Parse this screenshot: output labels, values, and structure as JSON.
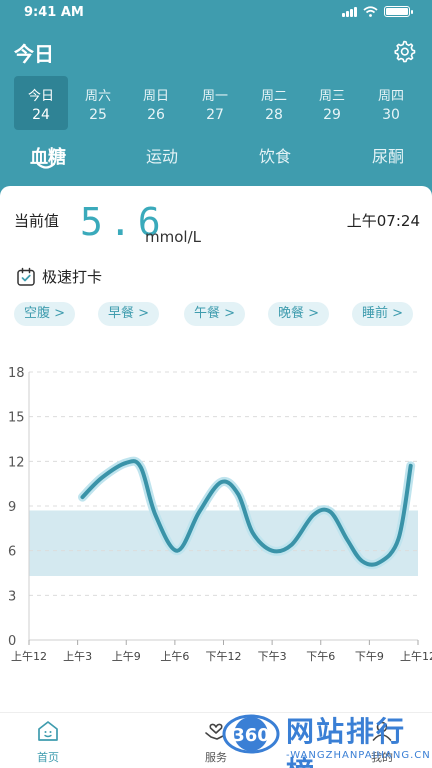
{
  "status_bar": {
    "time": "9:41 AM"
  },
  "header": {
    "title": "今日"
  },
  "dates": [
    {
      "dow": "今日",
      "num": "24",
      "active": true
    },
    {
      "dow": "周六",
      "num": "25",
      "active": false
    },
    {
      "dow": "周日",
      "num": "26",
      "active": false
    },
    {
      "dow": "周一",
      "num": "27",
      "active": false
    },
    {
      "dow": "周二",
      "num": "28",
      "active": false
    },
    {
      "dow": "周三",
      "num": "29",
      "active": false
    },
    {
      "dow": "周四",
      "num": "30",
      "active": false
    }
  ],
  "tabs": [
    {
      "label": "血糖",
      "active": true
    },
    {
      "label": "运动",
      "active": false
    },
    {
      "label": "饮食",
      "active": false
    },
    {
      "label": "尿酮",
      "active": false
    }
  ],
  "current": {
    "label": "当前值",
    "value": "5.6",
    "unit": "mmol/L",
    "time": "上午07:24"
  },
  "punch": {
    "label": "极速打卡"
  },
  "meal_tags": [
    "空腹 >",
    "早餐 >",
    "午餐 >",
    "晚餐 >",
    "睡前 >"
  ],
  "chart_data": {
    "type": "line",
    "categories": [
      "上午12",
      "上午3",
      "上午9",
      "上午6",
      "下午12",
      "下午3",
      "下午6",
      "下午9",
      "上午12"
    ],
    "yticks": [
      0,
      3,
      6,
      9,
      12,
      15,
      18
    ],
    "ylim": [
      0,
      18
    ],
    "target_range": [
      4.3,
      8.7
    ],
    "series": [
      {
        "points": [
          [
            1.1,
            9.6
          ],
          [
            1.5,
            10.9
          ],
          [
            2.0,
            11.9
          ],
          [
            2.3,
            11.6
          ],
          [
            2.6,
            8.4
          ],
          [
            3.05,
            6.0
          ],
          [
            3.5,
            8.6
          ],
          [
            3.95,
            10.6
          ],
          [
            4.3,
            9.8
          ],
          [
            4.6,
            7.2
          ],
          [
            5.0,
            6.0
          ],
          [
            5.4,
            6.4
          ],
          [
            5.85,
            8.4
          ],
          [
            6.2,
            8.6
          ],
          [
            6.55,
            6.7
          ],
          [
            6.85,
            5.3
          ],
          [
            7.2,
            5.2
          ],
          [
            7.6,
            6.8
          ],
          [
            7.85,
            11.7
          ]
        ]
      }
    ]
  },
  "colors": {
    "primary": "#3f9cae",
    "line": "#3a93a8",
    "band": "#d4e9f0"
  },
  "nav": [
    {
      "icon": "home-icon",
      "label": "首页",
      "active": true
    },
    {
      "icon": "service-icon",
      "label": "服务",
      "active": false
    },
    {
      "icon": "mine-icon",
      "label": "我的",
      "active": false
    }
  ],
  "watermark": {
    "badge": "360",
    "text": "网站排行榜",
    "url": "-WANGZHANPAIHANG.CN"
  }
}
